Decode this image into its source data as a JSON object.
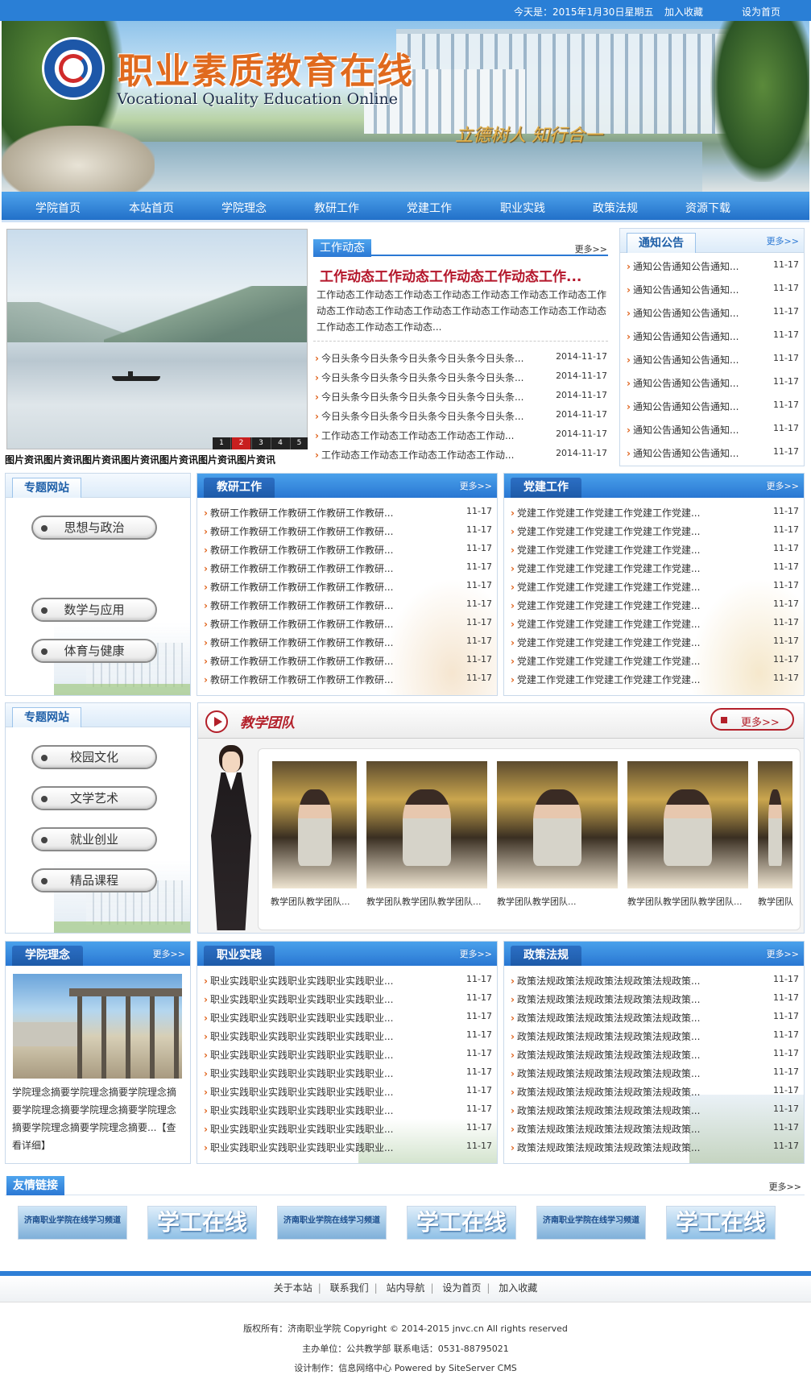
{
  "topbar": {
    "date": "今天是：2015年1月30日星期五",
    "bookmark": "加入收藏",
    "homepage": "设为首页"
  },
  "banner": {
    "title": "职业素质教育在线",
    "subtitle": "Vocational Quality Education Online",
    "motto": "立德树人  知行合一"
  },
  "nav": [
    "学院首页",
    "本站首页",
    "学院理念",
    "教研工作",
    "党建工作",
    "职业实践",
    "政策法规",
    "资源下载"
  ],
  "slider": {
    "caption": "图片资讯图片资讯图片资讯图片资讯图片资讯图片资讯图片资讯",
    "pages": [
      "1",
      "2",
      "3",
      "4",
      "5"
    ],
    "active_page": 2
  },
  "work_news": {
    "tab": "工作动态",
    "more": "更多>>",
    "headline": "工作动态工作动态工作动态工作动态工作...",
    "summary": "工作动态工作动态工作动态工作动态工作动态工作动态工作动态工作动态工作动态工作动态工作动态工作动态工作动态工作动态工作动态工作动态工作动态工作动态...",
    "items": [
      {
        "t": "今日头条今日头条今日头条今日头条今日头条...",
        "d": "2014-11-17"
      },
      {
        "t": "今日头条今日头条今日头条今日头条今日头条...",
        "d": "2014-11-17"
      },
      {
        "t": "今日头条今日头条今日头条今日头条今日头条...",
        "d": "2014-11-17"
      },
      {
        "t": "今日头条今日头条今日头条今日头条今日头条...",
        "d": "2014-11-17"
      },
      {
        "t": "工作动态工作动态工作动态工作动态工作动...",
        "d": "2014-11-17"
      },
      {
        "t": "工作动态工作动态工作动态工作动态工作动...",
        "d": "2014-11-17"
      }
    ]
  },
  "notice": {
    "tab": "通知公告",
    "more": "更多>>",
    "items": [
      {
        "t": "通知公告通知公告通知...",
        "d": "11-17"
      },
      {
        "t": "通知公告通知公告通知...",
        "d": "11-17"
      },
      {
        "t": "通知公告通知公告通知...",
        "d": "11-17"
      },
      {
        "t": "通知公告通知公告通知...",
        "d": "11-17"
      },
      {
        "t": "通知公告通知公告通知...",
        "d": "11-17"
      },
      {
        "t": "通知公告通知公告通知...",
        "d": "11-17"
      },
      {
        "t": "通知公告通知公告通知...",
        "d": "11-17"
      },
      {
        "t": "通知公告通知公告通知...",
        "d": "11-17"
      },
      {
        "t": "通知公告通知公告通知...",
        "d": "11-17"
      }
    ]
  },
  "topic1": {
    "tab": "专题网站",
    "items": [
      "思想与政治",
      "数学与应用",
      "体育与健康"
    ]
  },
  "teaching": {
    "tab": "教研工作",
    "more": "更多>>",
    "items": [
      {
        "t": "教研工作教研工作教研工作教研工作教研...",
        "d": "11-17"
      },
      {
        "t": "教研工作教研工作教研工作教研工作教研...",
        "d": "11-17"
      },
      {
        "t": "教研工作教研工作教研工作教研工作教研...",
        "d": "11-17"
      },
      {
        "t": "教研工作教研工作教研工作教研工作教研...",
        "d": "11-17"
      },
      {
        "t": "教研工作教研工作教研工作教研工作教研...",
        "d": "11-17"
      },
      {
        "t": "教研工作教研工作教研工作教研工作教研...",
        "d": "11-17"
      },
      {
        "t": "教研工作教研工作教研工作教研工作教研...",
        "d": "11-17"
      },
      {
        "t": "教研工作教研工作教研工作教研工作教研...",
        "d": "11-17"
      },
      {
        "t": "教研工作教研工作教研工作教研工作教研...",
        "d": "11-17"
      },
      {
        "t": "教研工作教研工作教研工作教研工作教研...",
        "d": "11-17"
      }
    ]
  },
  "party": {
    "tab": "党建工作",
    "more": "更多>>",
    "items": [
      {
        "t": "党建工作党建工作党建工作党建工作党建...",
        "d": "11-17"
      },
      {
        "t": "党建工作党建工作党建工作党建工作党建...",
        "d": "11-17"
      },
      {
        "t": "党建工作党建工作党建工作党建工作党建...",
        "d": "11-17"
      },
      {
        "t": "党建工作党建工作党建工作党建工作党建...",
        "d": "11-17"
      },
      {
        "t": "党建工作党建工作党建工作党建工作党建...",
        "d": "11-17"
      },
      {
        "t": "党建工作党建工作党建工作党建工作党建...",
        "d": "11-17"
      },
      {
        "t": "党建工作党建工作党建工作党建工作党建...",
        "d": "11-17"
      },
      {
        "t": "党建工作党建工作党建工作党建工作党建...",
        "d": "11-17"
      },
      {
        "t": "党建工作党建工作党建工作党建工作党建...",
        "d": "11-17"
      },
      {
        "t": "党建工作党建工作党建工作党建工作党建...",
        "d": "11-17"
      }
    ]
  },
  "topic2": {
    "tab": "专题网站",
    "items": [
      "校园文化",
      "文学艺术",
      "就业创业",
      "精品课程"
    ]
  },
  "team": {
    "title": "教学团队",
    "more": "更多>>",
    "captions": [
      "教学团队教学团队...",
      "教学团队教学团队教学团队...",
      "教学团队教学团队...",
      "教学团队教学团队教学团队...",
      "教学团队"
    ]
  },
  "philosophy": {
    "tab": "学院理念",
    "more": "更多>>",
    "text": "学院理念摘要学院理念摘要学院理念摘要学院理念摘要学院理念摘要学院理念摘要学院理念摘要学院理念摘要...",
    "detail": "【查看详细】"
  },
  "practice": {
    "tab": "职业实践",
    "more": "更多>>",
    "items": [
      {
        "t": "职业实践职业实践职业实践职业实践职业...",
        "d": "11-17"
      },
      {
        "t": "职业实践职业实践职业实践职业实践职业...",
        "d": "11-17"
      },
      {
        "t": "职业实践职业实践职业实践职业实践职业...",
        "d": "11-17"
      },
      {
        "t": "职业实践职业实践职业实践职业实践职业...",
        "d": "11-17"
      },
      {
        "t": "职业实践职业实践职业实践职业实践职业...",
        "d": "11-17"
      },
      {
        "t": "职业实践职业实践职业实践职业实践职业...",
        "d": "11-17"
      },
      {
        "t": "职业实践职业实践职业实践职业实践职业...",
        "d": "11-17"
      },
      {
        "t": "职业实践职业实践职业实践职业实践职业...",
        "d": "11-17"
      },
      {
        "t": "职业实践职业实践职业实践职业实践职业...",
        "d": "11-17"
      },
      {
        "t": "职业实践职业实践职业实践职业实践职业...",
        "d": "11-17"
      }
    ]
  },
  "policy": {
    "tab": "政策法规",
    "more": "更多>>",
    "items": [
      {
        "t": "政策法规政策法规政策法规政策法规政策...",
        "d": "11-17"
      },
      {
        "t": "政策法规政策法规政策法规政策法规政策...",
        "d": "11-17"
      },
      {
        "t": "政策法规政策法规政策法规政策法规政策...",
        "d": "11-17"
      },
      {
        "t": "政策法规政策法规政策法规政策法规政策...",
        "d": "11-17"
      },
      {
        "t": "政策法规政策法规政策法规政策法规政策...",
        "d": "11-17"
      },
      {
        "t": "政策法规政策法规政策法规政策法规政策...",
        "d": "11-17"
      },
      {
        "t": "政策法规政策法规政策法规政策法规政策...",
        "d": "11-17"
      },
      {
        "t": "政策法规政策法规政策法规政策法规政策...",
        "d": "11-17"
      },
      {
        "t": "政策法规政策法规政策法规政策法规政策...",
        "d": "11-17"
      },
      {
        "t": "政策法规政策法规政策法规政策法规政策...",
        "d": "11-17"
      }
    ]
  },
  "friend_links": {
    "tab": "友情链接",
    "more": "更多>>",
    "items": [
      "济南职业学院在线学习频道",
      "学工在线",
      "济南职业学院在线学习频道",
      "学工在线",
      "济南职业学院在线学习频道",
      "学工在线"
    ]
  },
  "footer": {
    "links": [
      "关于本站",
      "联系我们",
      "站内导航",
      "设为首页",
      "加入收藏"
    ],
    "copyright": "版权所有：济南职业学院 Copyright © 2014-2015 jnvc.cn All rights reserved",
    "host": "主办单位：公共教学部  联系电话：0531-88795021",
    "design": "设计制作：信息网络中心 Powered by SiteServer CMS"
  }
}
